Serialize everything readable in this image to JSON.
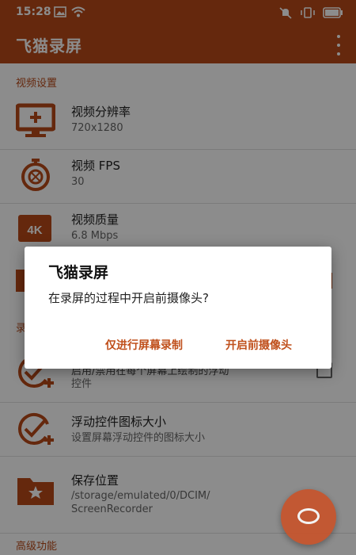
{
  "status_bar": {
    "time": "15:28"
  },
  "app_bar": {
    "title": "飞猫录屏"
  },
  "sections": {
    "video": "视频设置",
    "advanced": "高级功能",
    "partial_hidden": "录"
  },
  "rows": {
    "resolution": {
      "title": "视频分辨率",
      "value": "720x1280"
    },
    "fps": {
      "title": "视频 FPS",
      "value": "30"
    },
    "quality": {
      "title": "视频质量",
      "value": "6.8 Mbps"
    },
    "float_control": {
      "title": "启用/禁用在每个屏幕上绘制的浮动",
      "value": "控件"
    },
    "icon_size": {
      "title": "浮动控件图标大小",
      "value": "设置屏幕浮动控件的图标大小"
    },
    "save_location": {
      "title": "保存位置",
      "value_line1": "/storage/emulated/0/DCIM/",
      "value_line2": "ScreenRecorder"
    }
  },
  "dialog": {
    "title": "飞猫录屏",
    "message": "在录屏的过程中开启前摄像头?",
    "btn_record_only": "仅进行屏幕录制",
    "btn_open_camera": "开启前摄像头"
  },
  "colors": {
    "primary": "#b84a19",
    "accent": "#c0501c"
  }
}
